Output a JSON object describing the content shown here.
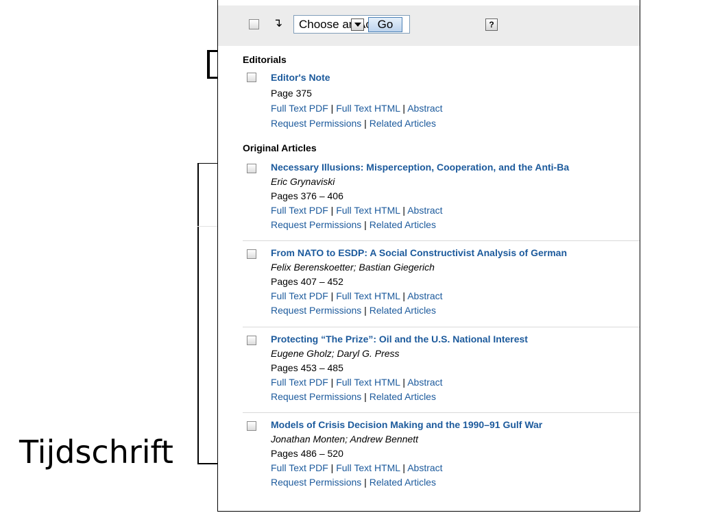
{
  "annotation": {
    "label": "Tijdschrift"
  },
  "toolbar": {
    "action_select_value": "Choose an Action:",
    "go_label": "Go",
    "help_label": "?",
    "corner_arrow": "↴"
  },
  "links": {
    "full_text_pdf": "Full Text PDF",
    "full_text_html": "Full Text HTML",
    "abstract": "Abstract",
    "request_permissions": "Request Permissions",
    "related_articles": "Related Articles",
    "separator": " | "
  },
  "sections": [
    {
      "heading": "Editorials",
      "articles": [
        {
          "title": "Editor's Note",
          "authors": "",
          "pages": "Page 375"
        }
      ]
    },
    {
      "heading": "Original Articles",
      "articles": [
        {
          "title": "Necessary Illusions: Misperception, Cooperation, and the Anti-Ba",
          "authors": "Eric Grynaviski",
          "pages": "Pages 376 – 406"
        },
        {
          "title": "From NATO to ESDP: A Social Constructivist Analysis of German",
          "authors": "Felix Berenskoetter; Bastian Giegerich",
          "pages": "Pages 407 – 452"
        },
        {
          "title": "Protecting “The Prize”: Oil and the U.S. National Interest",
          "authors": "Eugene Gholz; Daryl G. Press",
          "pages": "Pages 453 – 485"
        },
        {
          "title": "Models of Crisis Decision Making and the 1990–91 Gulf War",
          "authors": "Jonathan Monten; Andrew Bennett",
          "pages": "Pages 486 – 520"
        }
      ]
    }
  ]
}
